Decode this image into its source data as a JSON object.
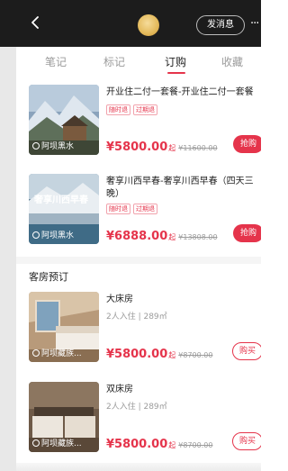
{
  "header": {
    "back_icon": "chevron-left-icon",
    "message_button": "发消息",
    "more_icon": "ellipsis-icon"
  },
  "tabs": [
    {
      "label": "笔记",
      "active": false
    },
    {
      "label": "标记",
      "active": false
    },
    {
      "label": "订购",
      "active": true
    },
    {
      "label": "收藏",
      "active": false
    }
  ],
  "packages": [
    {
      "title": "开业住二付一套餐-开业住二付一套餐",
      "tags": [
        "随时退",
        "过期退"
      ],
      "price": "¥5800.00",
      "price_suffix": "起",
      "original_price": "¥11600.00",
      "button": "抢购",
      "location": "阿坝黑水"
    },
    {
      "title": "奢享川西早春-奢享川西早春（四天三晚）",
      "tags": [
        "随时退",
        "过期退"
      ],
      "price": "¥6888.00",
      "price_suffix": "起",
      "original_price": "¥13808.00",
      "button": "抢购",
      "location": "阿坝黑水",
      "thumb_text": "奢享川西早春"
    }
  ],
  "rooms_section": {
    "title": "客房预订",
    "rooms": [
      {
        "title": "大床房",
        "sub": "2人入住 | 289㎡",
        "price": "¥5800.00",
        "price_suffix": "起",
        "original_price": "¥8700.00",
        "button": "购买",
        "location": "阿坝藏族..."
      },
      {
        "title": "双床房",
        "sub": "2人入住 | 289㎡",
        "price": "¥5800.00",
        "price_suffix": "起",
        "original_price": "¥8700.00",
        "button": "购买",
        "location": "阿坝藏族..."
      }
    ]
  },
  "colors": {
    "accent": "#e5344b",
    "header_bg": "#1c1c1c",
    "muted_text": "#9b9b9b"
  }
}
